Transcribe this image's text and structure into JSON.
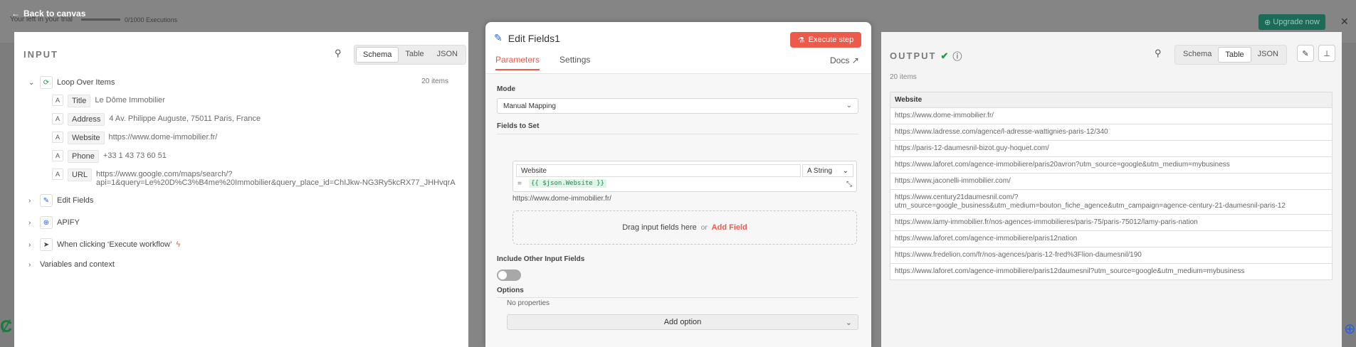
{
  "app": {
    "back_label": "Back to canvas",
    "trial_text": "Your left in your trial",
    "trial_count": "0/1000 Executions",
    "upgrade_label": "Upgrade now"
  },
  "input": {
    "title": "INPUT",
    "views": [
      "Schema",
      "Table",
      "JSON"
    ],
    "active_view": "Schema",
    "root_node": "Loop Over Items",
    "items_count": "20 items",
    "fields": [
      {
        "type": "A",
        "key": "Title",
        "value": "Le Dôme Immobilier"
      },
      {
        "type": "A",
        "key": "Address",
        "value": "4 Av. Philippe Auguste, 75011 Paris, France"
      },
      {
        "type": "A",
        "key": "Website",
        "value": "https://www.dome-immobilier.fr/"
      },
      {
        "type": "A",
        "key": "Phone",
        "value": "+33 1 43 73 60 51"
      },
      {
        "type": "A",
        "key": "URL",
        "value": "https://www.google.com/maps/search/?",
        "value2": "api=1&query=Le%20D%C3%B4me%20Immobilier&query_place_id=ChIJkw-NG3Ry5kcRX77_JHHvqrA"
      }
    ],
    "other_nodes": [
      "Edit Fields",
      "APIFY",
      "When clicking ‘Execute workflow’"
    ],
    "variables_label": "Variables and context"
  },
  "editor": {
    "title": "Edit Fields1",
    "execute_label": "Execute step",
    "tabs": [
      "Parameters",
      "Settings"
    ],
    "docs_label": "Docs",
    "mode_label": "Mode",
    "mode_value": "Manual Mapping",
    "fields_to_set_label": "Fields to Set",
    "assignment": {
      "name": "Website",
      "type": "String",
      "eq": "=",
      "expression": "{{ $json.Website }}",
      "preview": "https://www.dome-immobilier.fr/"
    },
    "drag_text": "Drag input fields here",
    "or_text": "or",
    "add_field_label": "Add Field",
    "include_label": "Include Other Input Fields",
    "include_enabled": false,
    "options_label": "Options",
    "no_properties": "No properties",
    "add_option_label": "Add option"
  },
  "output": {
    "title": "OUTPUT",
    "items_count": "20 items",
    "views": [
      "Schema",
      "Table",
      "JSON"
    ],
    "active_view": "Table",
    "column": "Website",
    "rows": [
      "https://www.dome-immobilier.fr/",
      "https://www.ladresse.com/agence/l-adresse-wattignies-paris-12/340",
      "https://paris-12-daumesnil-bizot.guy-hoquet.com/",
      "https://www.laforet.com/agence-immobiliere/paris20avron?utm_source=google&utm_medium=mybusiness",
      "https://www.jaconelli-immobilier.com/",
      "https://www.century21daumesnil.com/?",
      "https://www.lamy-immobilier.fr/nos-agences-immobilieres/paris-75/paris-75012/lamy-paris-nation",
      "https://www.laforet.com/agence-immobiliere/paris12nation",
      "https://www.fredelion.com/fr/nos-agences/paris-12-fred%3Flion-daumesnil/190",
      "https://www.laforet.com/agence-immobiliere/paris12daumesnil?utm_source=google&utm_medium=mybusiness"
    ],
    "row6_line2": "utm_source=google_business&utm_medium=bouton_fiche_agence&utm_campaign=agence-century-21-daumesnil-paris-12"
  },
  "colors": {
    "accent": "#ec5a4b",
    "success": "#1b9e4b"
  }
}
